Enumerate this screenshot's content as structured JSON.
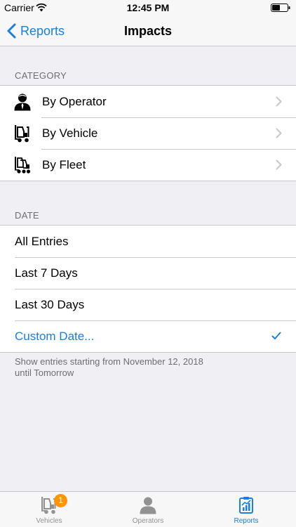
{
  "status_bar": {
    "carrier": "Carrier",
    "time": "12:45 PM"
  },
  "nav": {
    "back_label": "Reports",
    "title": "Impacts"
  },
  "category": {
    "header": "CATEGORY",
    "items": [
      {
        "label": "By Operator",
        "icon": "operator-icon"
      },
      {
        "label": "By Vehicle",
        "icon": "forklift-icon"
      },
      {
        "label": "By Fleet",
        "icon": "fleet-icon"
      }
    ]
  },
  "date": {
    "header": "DATE",
    "items": [
      {
        "label": "All Entries",
        "selected": false
      },
      {
        "label": "Last 7 Days",
        "selected": false
      },
      {
        "label": "Last 30 Days",
        "selected": false
      },
      {
        "label": "Custom Date...",
        "selected": true
      }
    ],
    "footer_line1": "Show entries starting from November 12, 2018",
    "footer_line2": "until Tomorrow"
  },
  "tabs": [
    {
      "label": "Vehicles",
      "badge": "1",
      "icon": "forklift-icon",
      "active": false
    },
    {
      "label": "Operators",
      "icon": "operator-icon",
      "active": false
    },
    {
      "label": "Reports",
      "icon": "reports-icon",
      "active": true
    }
  ],
  "colors": {
    "accent": "#1a7ee2",
    "badge": "#ff9500",
    "background": "#efeff4"
  }
}
